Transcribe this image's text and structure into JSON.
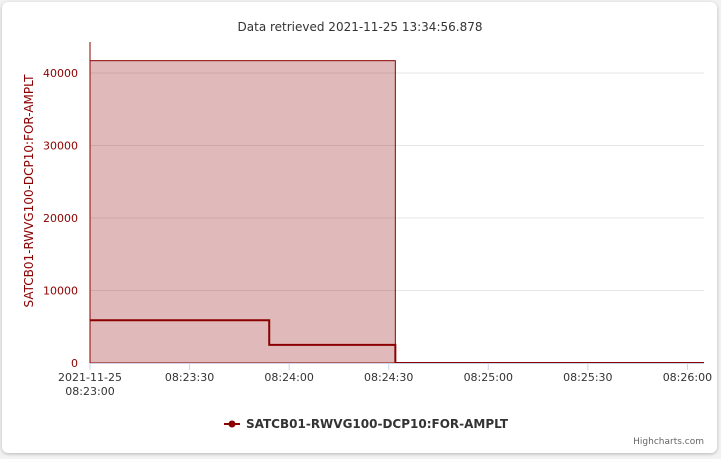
{
  "chart_data": {
    "type": "area",
    "step": "left",
    "subtitle": "Data retrieved 2021-11-25 13:34:56.878",
    "ylabel": "SATCB01-RWVG100-DCP10:FOR-AMPLT",
    "xlabel": "",
    "ylim": [
      0,
      44000
    ],
    "yticks": [
      0,
      10000,
      20000,
      30000,
      40000
    ],
    "xlim": [
      "2021-11-25 08:23:00",
      "2021-11-25 08:26:05"
    ],
    "xticks": [
      {
        "time": "2021-11-25 08:23:00",
        "label": [
          "2021-11-25",
          "08:23:00"
        ]
      },
      {
        "time": "2021-11-25 08:23:30",
        "label": [
          "08:23:30"
        ]
      },
      {
        "time": "2021-11-25 08:24:00",
        "label": [
          "08:24:00"
        ]
      },
      {
        "time": "2021-11-25 08:24:30",
        "label": [
          "08:24:30"
        ]
      },
      {
        "time": "2021-11-25 08:25:00",
        "label": [
          "08:25:00"
        ]
      },
      {
        "time": "2021-11-25 08:25:30",
        "label": [
          "08:25:30"
        ]
      },
      {
        "time": "2021-11-25 08:26:00",
        "label": [
          "08:26:00"
        ]
      }
    ],
    "grid": true,
    "legend_position": "bottom-center",
    "series": [
      {
        "name": "SATCB01-RWVG100-DCP10:FOR-AMPLT",
        "color": "#8b0000",
        "line": {
          "x": [
            "2021-11-25 08:23:00",
            "2021-11-25 08:23:54",
            "2021-11-25 08:24:32",
            "2021-11-25 08:26:05"
          ],
          "y": [
            5900,
            2500,
            0,
            0
          ]
        },
        "band": {
          "x": [
            "2021-11-25 08:23:00",
            "2021-11-25 08:24:32"
          ],
          "y_low": 0,
          "y_high": 41700
        }
      }
    ],
    "credits": "Highcharts.com"
  }
}
